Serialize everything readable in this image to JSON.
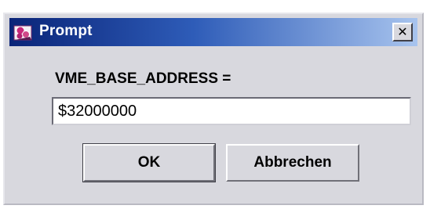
{
  "dialog": {
    "title": "Prompt",
    "app_icon": "java-dialog-icon",
    "close_glyph": "✕",
    "label": "VME_BASE_ADDRESS =",
    "input_value": "$32000000",
    "ok_label": "OK",
    "cancel_label": "Abbrechen"
  },
  "colors": {
    "titlebar_start": "#0a2478",
    "titlebar_end": "#a8c4ee",
    "dialog_background": "#d8d8de"
  }
}
